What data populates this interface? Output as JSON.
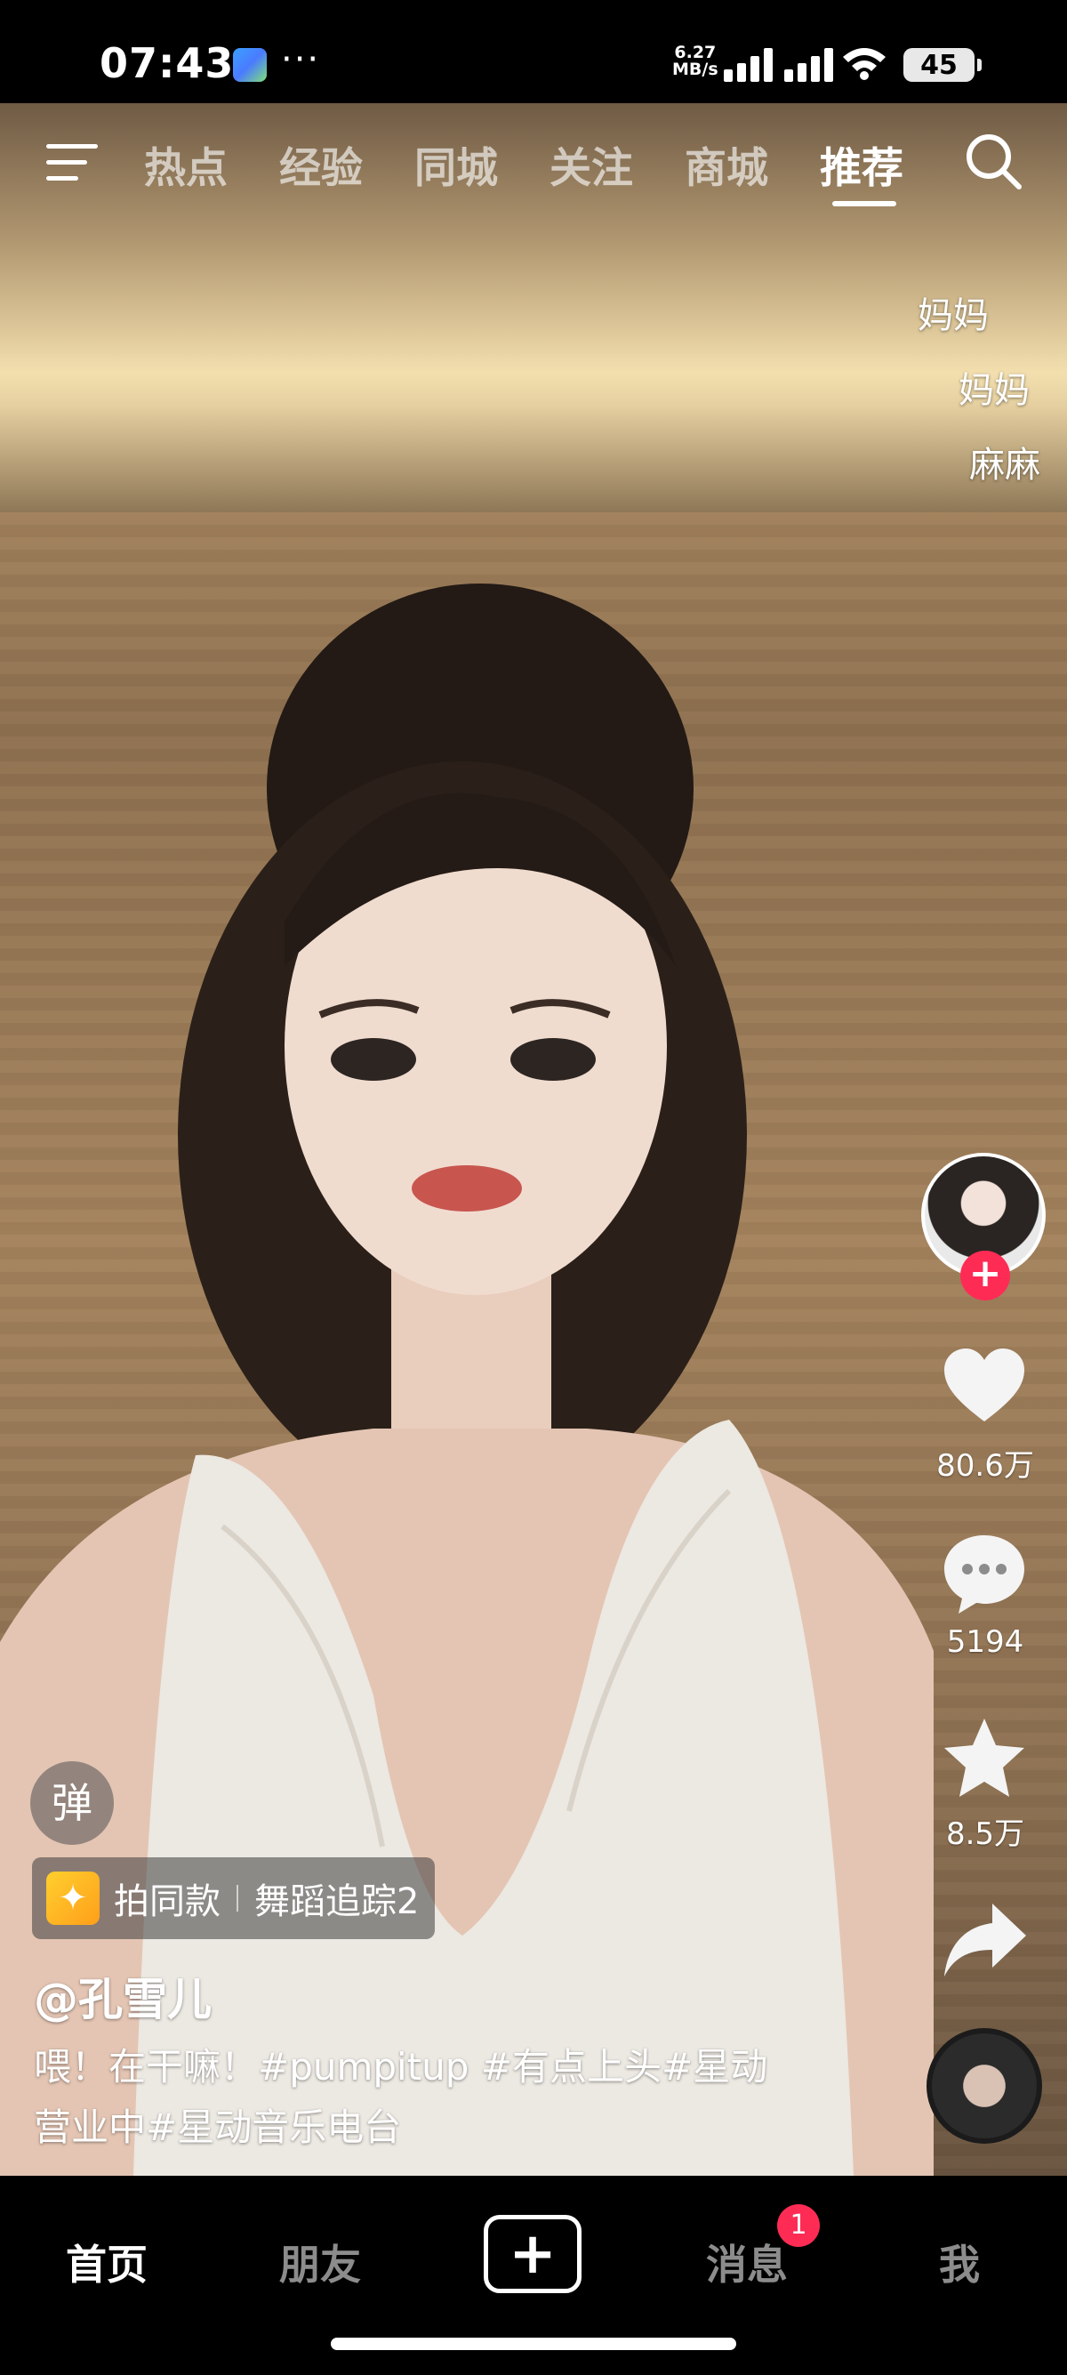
{
  "status_bar": {
    "time": "07:43",
    "dots": "···",
    "net_speed_value": "6.27",
    "net_speed_unit": "MB/s",
    "battery": "45",
    "icons": [
      "gallery-app-icon",
      "signal-icon",
      "wifi-icon",
      "battery-icon"
    ]
  },
  "top_nav": {
    "tabs": [
      {
        "label": "热点"
      },
      {
        "label": "经验"
      },
      {
        "label": "同城"
      },
      {
        "label": "关注"
      },
      {
        "label": "商城"
      },
      {
        "label": "推荐"
      }
    ],
    "active_tab": "推荐"
  },
  "danmaku": [
    "妈妈",
    "妈妈",
    "麻麻"
  ],
  "right_rail": {
    "likes": "80.6万",
    "comments": "5194",
    "favorites": "8.5万",
    "follow_label": "+"
  },
  "overlay": {
    "danmaku_toggle": "弹",
    "effect_label": "拍同款",
    "effect_name": "舞蹈追踪2",
    "author": "@孔雪儿",
    "caption": "喂！在干嘛！#pumpitup #有点上头#星动营业中#星动音乐电台"
  },
  "bottom_nav": {
    "items": [
      {
        "label": "首页"
      },
      {
        "label": "朋友"
      },
      {
        "label": "消息"
      },
      {
        "label": "我"
      }
    ],
    "add_label": "+",
    "messages_badge": "1"
  },
  "colors": {
    "accent": "#fe2c55",
    "background": "#000000"
  }
}
